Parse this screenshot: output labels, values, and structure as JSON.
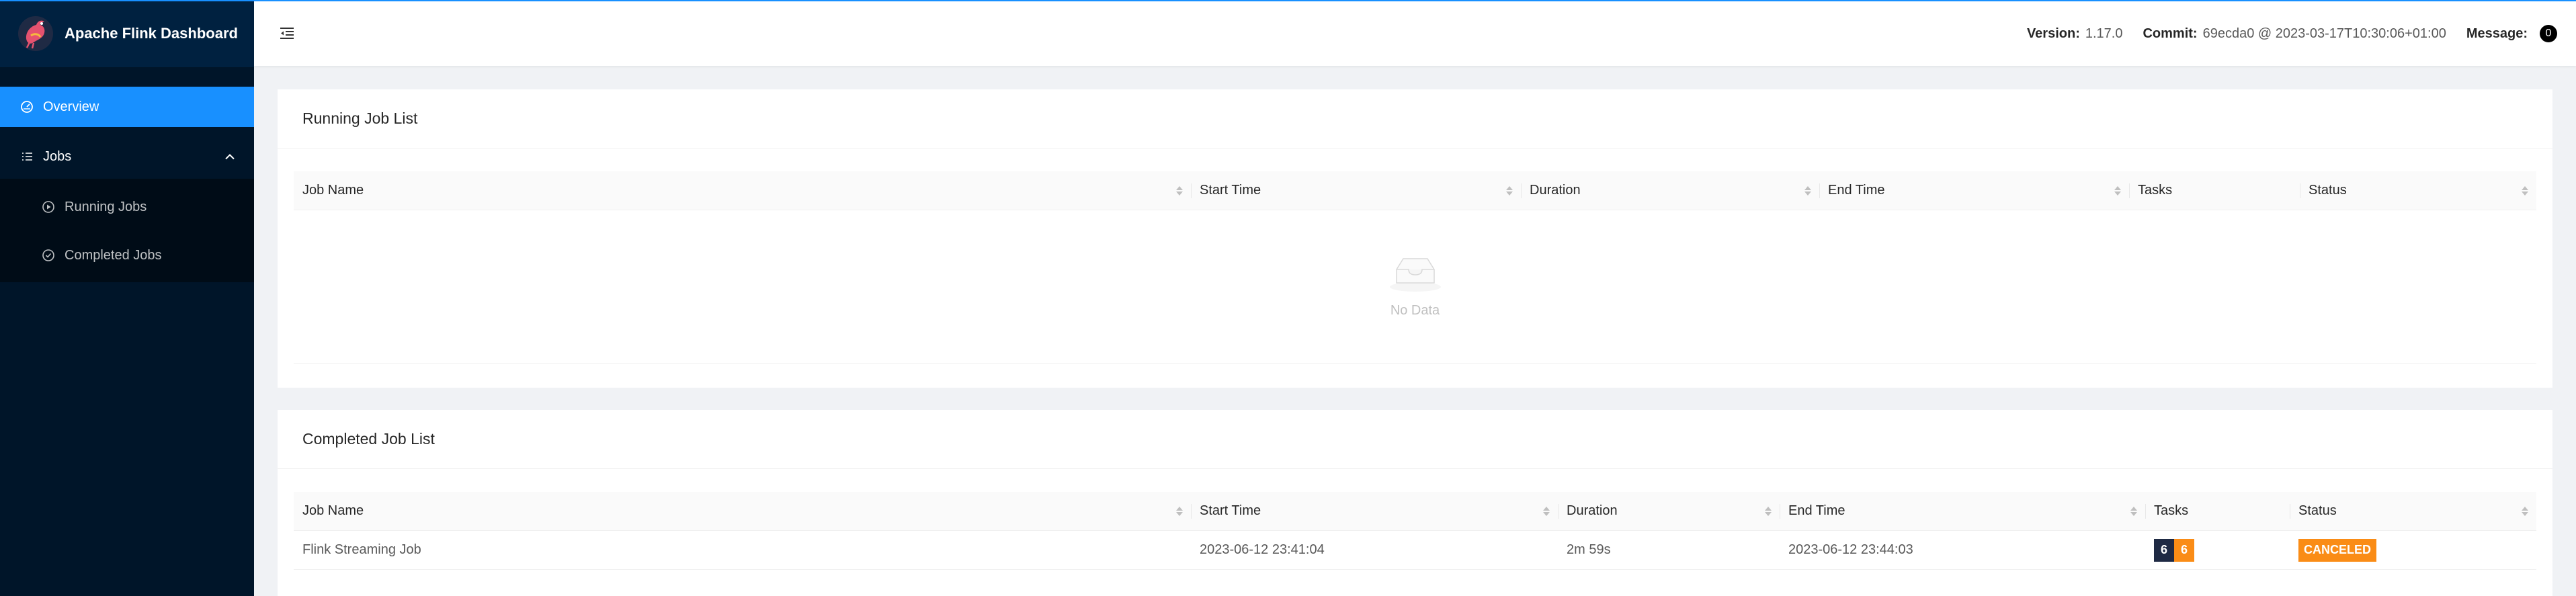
{
  "app": {
    "title": "Apache Flink Dashboard",
    "accent": "#1890ff",
    "sidebar_bg": "#001529"
  },
  "sidebar": {
    "items": [
      {
        "label": "Overview",
        "icon": "dashboard-icon",
        "active": true
      },
      {
        "label": "Jobs",
        "icon": "list-icon",
        "expanded": true
      }
    ],
    "jobs_sub": [
      {
        "label": "Running Jobs",
        "icon": "play-circle-icon"
      },
      {
        "label": "Completed Jobs",
        "icon": "check-circle-icon"
      }
    ]
  },
  "header": {
    "version_label": "Version:",
    "version_value": "1.17.0",
    "commit_label": "Commit:",
    "commit_value": "69ecda0 @ 2023-03-17T10:30:06+01:00",
    "message_label": "Message:",
    "message_count": "0"
  },
  "running": {
    "title": "Running Job List",
    "columns": [
      "Job Name",
      "Start Time",
      "Duration",
      "End Time",
      "Tasks",
      "Status"
    ],
    "empty_text": "No Data"
  },
  "completed": {
    "title": "Completed Job List",
    "columns": [
      "Job Name",
      "Start Time",
      "Duration",
      "End Time",
      "Tasks",
      "Status"
    ],
    "rows": [
      {
        "name": "Flink Streaming Job",
        "start": "2023-06-12 23:41:04",
        "duration": "2m 59s",
        "end": "2023-06-12 23:44:03",
        "tasks_total": "6",
        "tasks_canceled": "6",
        "status": "CANCELED",
        "status_color": "#fa8c16"
      }
    ]
  }
}
